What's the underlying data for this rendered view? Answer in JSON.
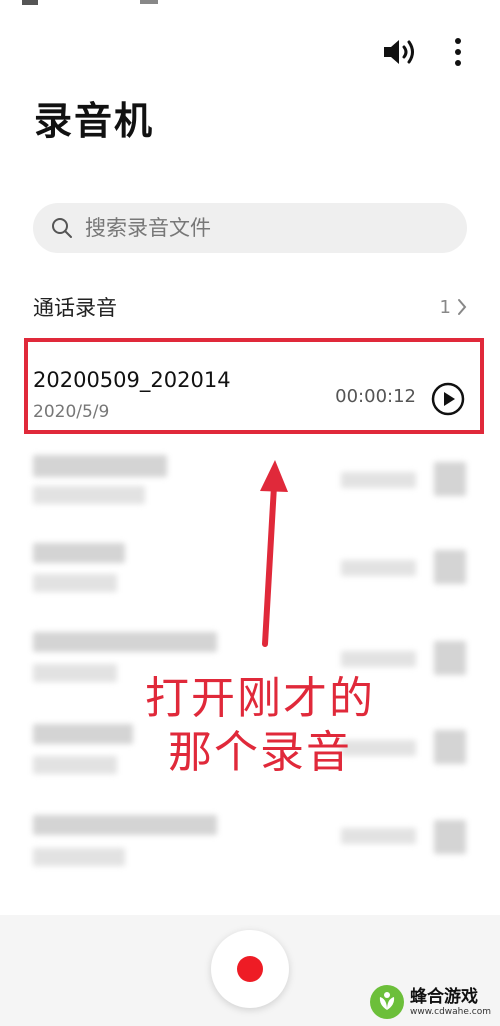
{
  "app": {
    "title": "录音机"
  },
  "search": {
    "placeholder": "搜索录音文件"
  },
  "section": {
    "title": "通话录音",
    "count": "1"
  },
  "recording": {
    "name": "20200509_202014",
    "date": "2020/5/9",
    "duration": "00:00:12"
  },
  "annotation": {
    "line1": "打开刚才的",
    "line2": "那个录音"
  },
  "watermark": {
    "name": "蜂合游戏",
    "url": "www.cdwahe.com"
  },
  "icons": {
    "speaker": "speaker-icon",
    "more": "more-vertical-icon",
    "search": "search-icon",
    "chevron": "chevron-right-icon",
    "play": "play-icon",
    "record": "record-icon"
  },
  "colors": {
    "accent_red": "#e0293a",
    "record_red": "#ee1c25",
    "search_bg": "#efefef"
  }
}
